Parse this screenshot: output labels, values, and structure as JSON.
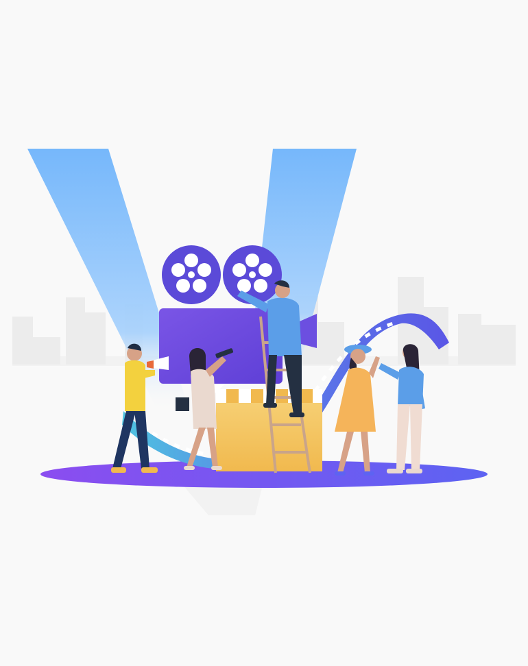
{
  "scene": {
    "subject": "film-production-crew-illustration",
    "colors": {
      "background": "#f9f9f9",
      "spotlight": "#6fb4fb",
      "camera_body": "#6c4fe0",
      "camera_reel": "#5b4ad8",
      "clapperboard": "#f5c96b",
      "film_strip_a": "#4fb3e6",
      "film_strip_b": "#5a56e6",
      "floor_left": "#8b4df0",
      "floor_right": "#5d63f2",
      "skyline": "#ececec"
    },
    "figures": [
      {
        "role": "director-with-megaphone",
        "shirt": "#f3d13e",
        "pants": "#1f3561"
      },
      {
        "role": "woman-with-telescope",
        "dress": "#ead9cf"
      },
      {
        "role": "man-on-ladder",
        "shirt": "#5b9ee8",
        "pants": "#243042"
      },
      {
        "role": "actress-in-hat",
        "dress": "#f5b45a"
      },
      {
        "role": "makeup-artist",
        "shirt": "#5b9ee8",
        "pants": "#f0dcd2"
      }
    ]
  }
}
